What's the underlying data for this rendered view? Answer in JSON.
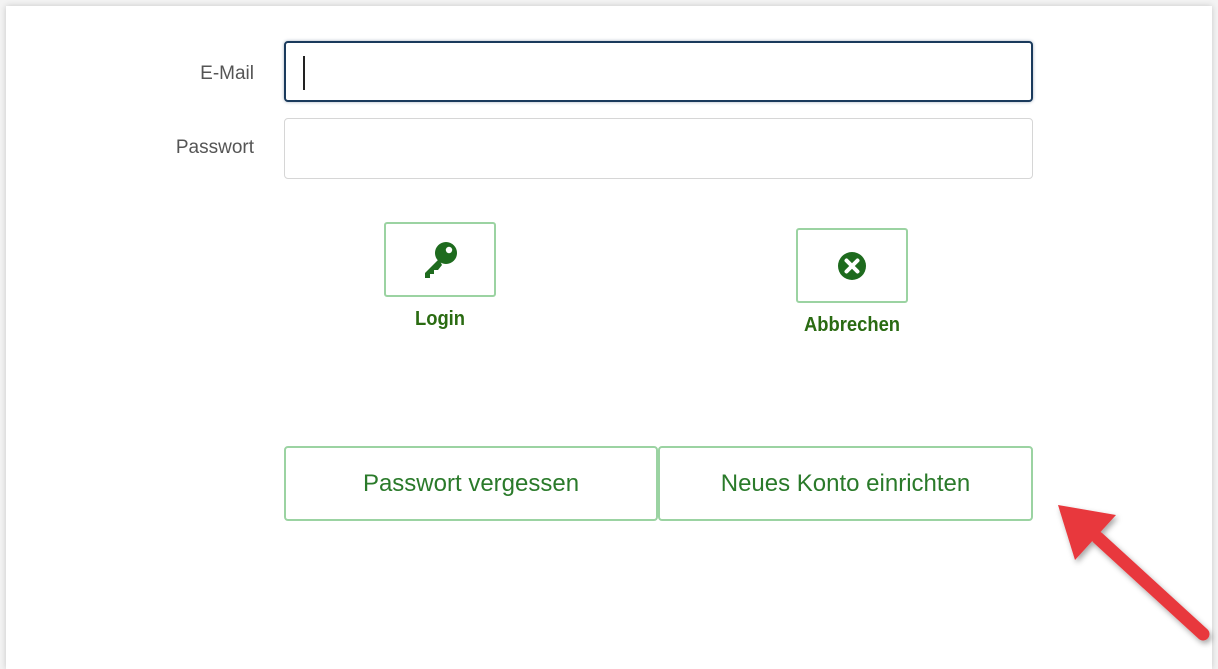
{
  "form": {
    "email_label": "E-Mail",
    "email_value": "",
    "password_label": "Passwort",
    "password_value": ""
  },
  "actions": {
    "login_label": "Login",
    "cancel_label": "Abbrechen",
    "forgot_password_label": "Passwort vergessen",
    "new_account_label": "Neues Konto einrichten"
  },
  "icons": {
    "login": "key-icon",
    "cancel": "circle-x-icon",
    "annotation": "arrow-annotation"
  },
  "colors": {
    "accent_green": "#2a7a2a",
    "icon_green": "#1e6b1e",
    "button_border": "#9bd3a2",
    "focus_border": "#1a3a5c",
    "annotation_red": "#e8383c"
  }
}
